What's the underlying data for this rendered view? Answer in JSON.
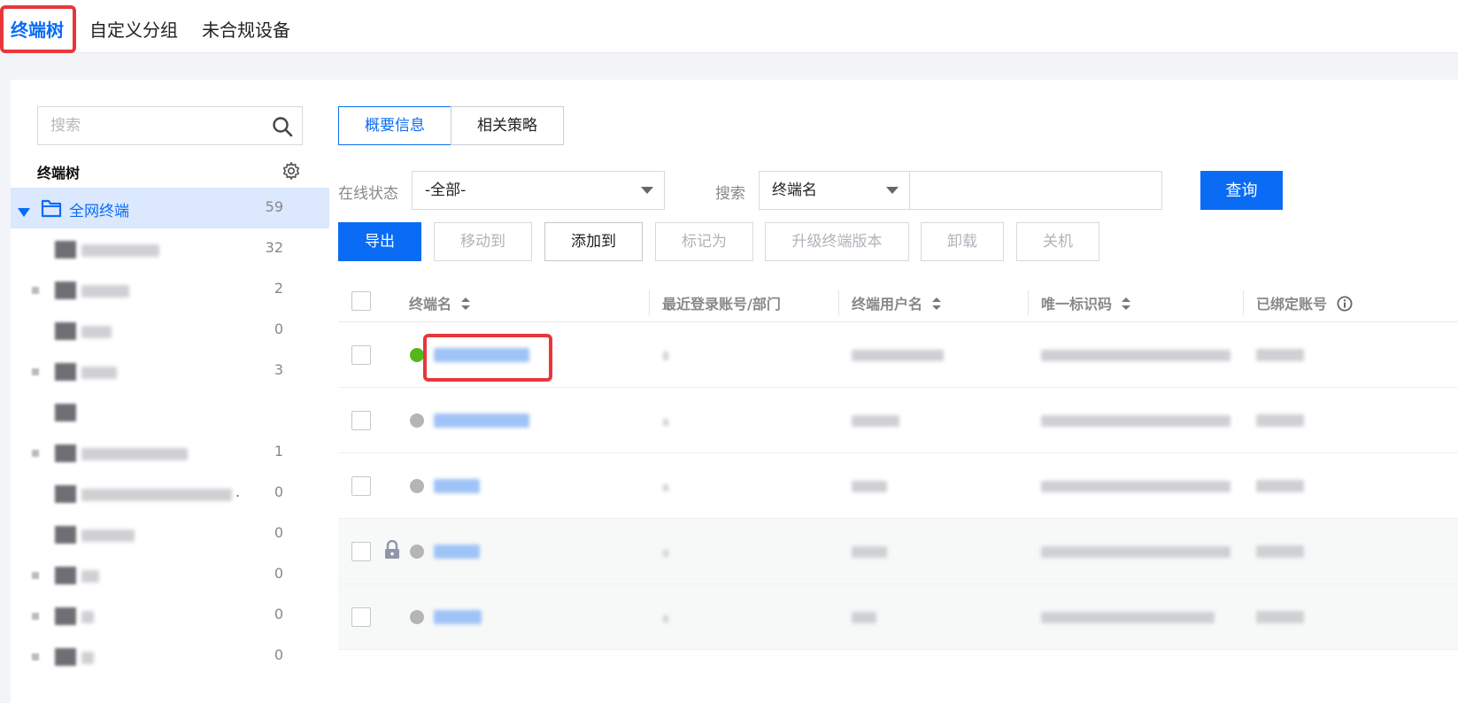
{
  "top_tabs": [
    {
      "label": "终端树",
      "active": true
    },
    {
      "label": "自定义分组",
      "active": false
    },
    {
      "label": "未合规设备",
      "active": false
    }
  ],
  "sidebar": {
    "search_placeholder": "搜索",
    "tree_title": "终端树",
    "root": {
      "label": "全网终端",
      "count": "59"
    },
    "items": [
      {
        "count": "32"
      },
      {
        "count": "2"
      },
      {
        "count": "0"
      },
      {
        "count": "3"
      },
      {
        "count": ""
      },
      {
        "count": "1"
      },
      {
        "count": "0"
      },
      {
        "count": "0"
      },
      {
        "count": "0"
      },
      {
        "count": "0"
      },
      {
        "count": "0"
      }
    ],
    "ellipsis": "."
  },
  "main": {
    "seg_tabs": [
      {
        "label": "概要信息",
        "active": true
      },
      {
        "label": "相关策略",
        "active": false
      }
    ],
    "filters": {
      "online_label": "在线状态",
      "online_value": "-全部-",
      "search_label": "搜索",
      "search_field": "终端名",
      "query_button": "查询"
    },
    "actions": {
      "export": "导出",
      "move_to": "移动到",
      "add_to": "添加到",
      "mark_as": "标记为",
      "upgrade": "升级终端版本",
      "uninstall": "卸载",
      "shutdown": "关机"
    },
    "table": {
      "headers": [
        "终端名",
        "最近登录账号/部门",
        "终端用户名",
        "唯一标识码",
        "已绑定账号"
      ]
    }
  },
  "colors": {
    "accent": "#0a6cf5",
    "online": "#52b81c",
    "offline": "#b5b5b5",
    "highlight": "#e8373b"
  }
}
